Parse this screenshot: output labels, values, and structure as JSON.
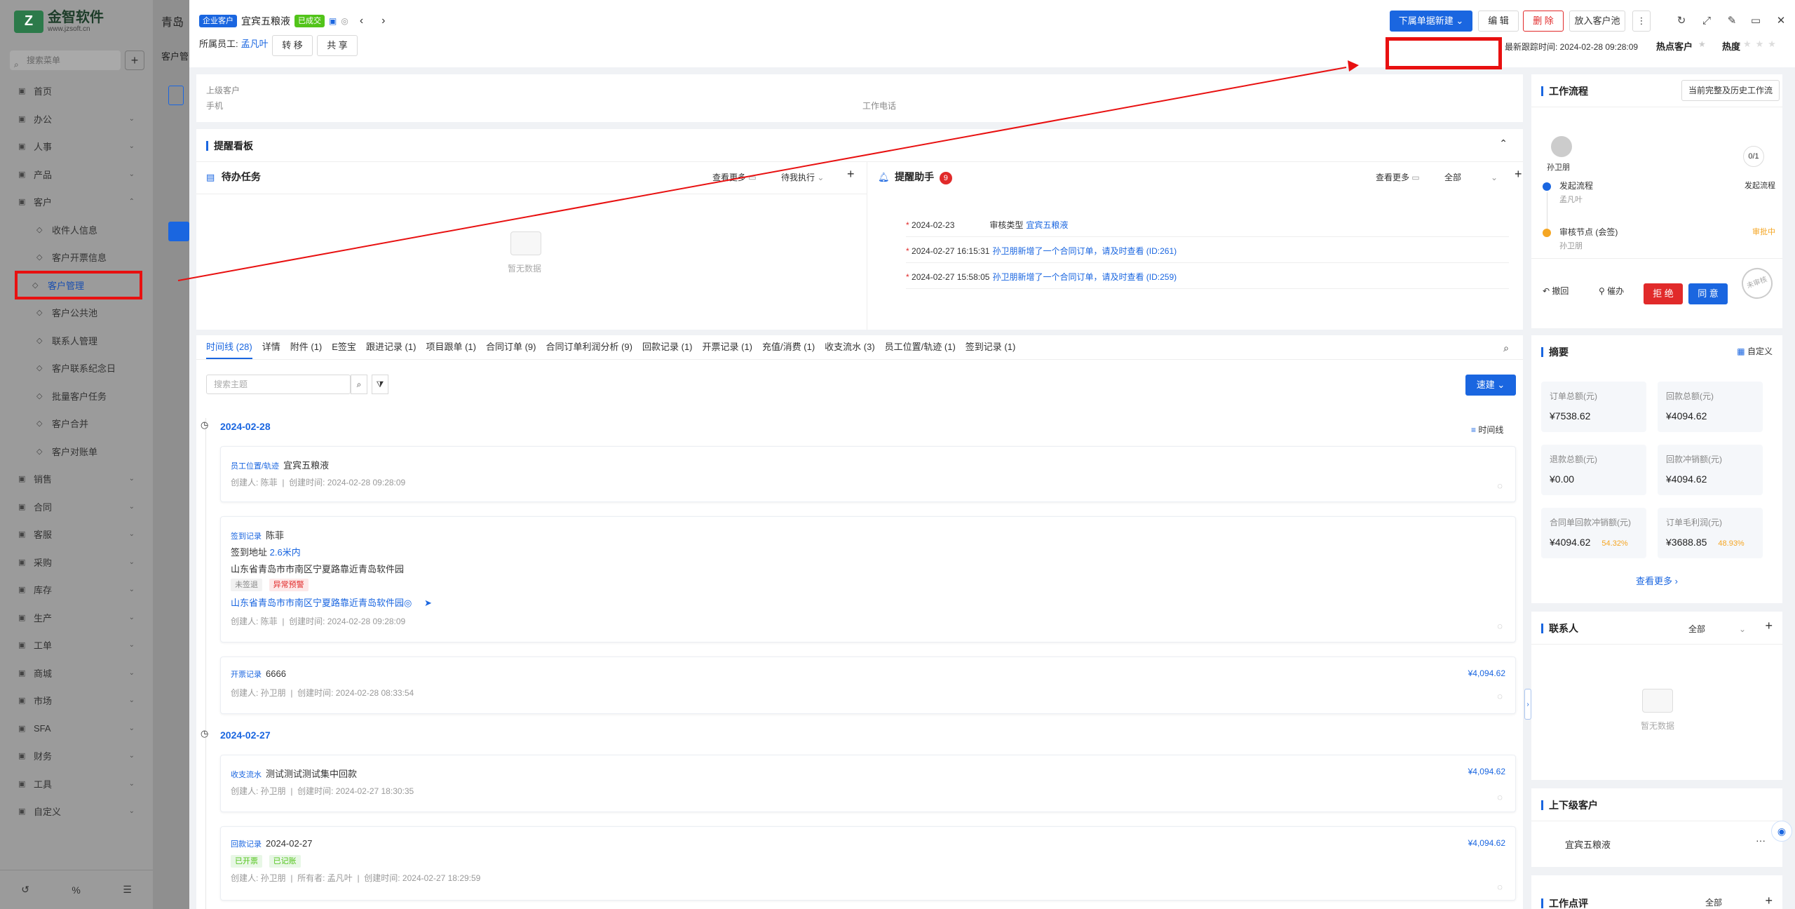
{
  "sidebar": {
    "logo_text": "金智软件",
    "logo_sub": "www.jzsoft.cn",
    "search_placeholder": "搜索菜单",
    "items": [
      {
        "label": "首页",
        "icon": "home-icon"
      },
      {
        "label": "办公",
        "icon": "office-icon"
      },
      {
        "label": "人事",
        "icon": "person-icon"
      },
      {
        "label": "产品",
        "icon": "product-icon"
      },
      {
        "label": "客户",
        "icon": "customer-icon"
      },
      {
        "label": "收件人信息",
        "icon": "sub-icon"
      },
      {
        "label": "客户开票信息",
        "icon": "sub-icon"
      },
      {
        "label": "客户管理",
        "icon": "sub-icon"
      },
      {
        "label": "客户公共池",
        "icon": "sub-icon"
      },
      {
        "label": "联系人管理",
        "icon": "sub-icon"
      },
      {
        "label": "客户联系纪念日",
        "icon": "sub-icon"
      },
      {
        "label": "批量客户任务",
        "icon": "sub-icon"
      },
      {
        "label": "客户合并",
        "icon": "sub-icon"
      },
      {
        "label": "客户对账单",
        "icon": "sub-icon"
      },
      {
        "label": "销售",
        "icon": "sales-icon"
      },
      {
        "label": "合同",
        "icon": "contract-icon"
      },
      {
        "label": "客服",
        "icon": "service-icon"
      },
      {
        "label": "采购",
        "icon": "purchase-icon"
      },
      {
        "label": "库存",
        "icon": "stock-icon"
      },
      {
        "label": "生产",
        "icon": "production-icon"
      },
      {
        "label": "工单",
        "icon": "ticket-icon"
      },
      {
        "label": "商城",
        "icon": "mall-icon"
      },
      {
        "label": "市场",
        "icon": "market-icon"
      },
      {
        "label": "SFA",
        "icon": "sfa-icon"
      },
      {
        "label": "财务",
        "icon": "finance-icon"
      },
      {
        "label": "工具",
        "icon": "tool-icon"
      },
      {
        "label": "自定义",
        "icon": "custom-icon"
      }
    ],
    "bottom": [
      "↺",
      "%",
      "☰"
    ]
  },
  "background": {
    "title": "青岛",
    "sub": "客户管"
  },
  "header": {
    "tag_type": "企业客户",
    "customer_name": "宜宾五粮液",
    "tag_status": "已成交",
    "owner_label": "所属员工:",
    "owner_name": "孟凡叶",
    "transfer_btn": "转 移",
    "share_btn": "共 享",
    "new_order_btn": "下属单据新建",
    "edit_btn": "编 辑",
    "delete_btn": "删 除",
    "pool_btn": "放入客户池",
    "last_follow": "最新跟踪时间: 2024-02-28 09:28:09",
    "hot_customer": "热点客户",
    "heat_label": "热度"
  },
  "info": {
    "parent_label": "上级客户",
    "mobile_label": "手机",
    "work_phone_label": "工作电话"
  },
  "reminder": {
    "title": "提醒看板",
    "todo": {
      "title": "待办任务",
      "more": "查看更多",
      "filter": "待我执行",
      "empty": "暂无数据"
    },
    "assistant": {
      "title": "提醒助手",
      "count": "9",
      "more": "查看更多",
      "filter": "全部",
      "items": [
        {
          "time": "2024-02-23",
          "text": "审核类型",
          "link": "宜宾五粮液"
        },
        {
          "time": "2024-02-27 16:15:31",
          "text": "",
          "link": "孙卫朋新增了一个合同订单，请及时查看 (ID:261)"
        },
        {
          "time": "2024-02-27 15:58:05",
          "text": "",
          "link": "孙卫朋新增了一个合同订单，请及时查看 (ID:259)"
        }
      ]
    }
  },
  "tabs": [
    "时间线 (28)",
    "详情",
    "附件 (1)",
    "E签宝",
    "跟进记录 (1)",
    "项目跟单 (1)",
    "合同订单 (9)",
    "合同订单利润分析 (9)",
    "回款记录 (1)",
    "开票记录 (1)",
    "充值/消费 (1)",
    "收支流水 (3)",
    "员工位置/轨迹 (1)",
    "签到记录 (1)"
  ],
  "timeline": {
    "search_placeholder": "搜索主题",
    "quick_btn": "速建",
    "timeline_toggle": "时间线",
    "dates": [
      "2024-02-28",
      "2024-02-27"
    ],
    "entries": [
      {
        "type": "员工位置/轨迹",
        "title": "宜宾五粮液",
        "creator": "创建人: 陈菲",
        "time": "创建时间: 2024-02-28 09:28:09"
      },
      {
        "type": "签到记录",
        "title": "陈菲",
        "line1": "签到地址",
        "distance": "2.6米内",
        "address": "山东省青岛市市南区宁夏路靠近青岛软件园",
        "tag1": "未签退",
        "tag2": "异常预警",
        "address_link": "山东省青岛市市南区宁夏路靠近青岛软件园◎",
        "creator": "创建人: 陈菲",
        "time": "创建时间: 2024-02-28 09:28:09"
      },
      {
        "type": "开票记录",
        "title": "6666",
        "amount": "¥4,094.62",
        "creator": "创建人: 孙卫朋",
        "time": "创建时间: 2024-02-28 08:33:54"
      },
      {
        "type": "收支流水",
        "title": "测试测试测试集中回款",
        "amount": "¥4,094.62",
        "creator": "创建人: 孙卫朋",
        "time": "创建时间: 2024-02-27 18:30:35"
      },
      {
        "type": "回款记录",
        "title": "2024-02-27",
        "amount": "¥4,094.62",
        "tag1": "已开票",
        "tag2": "已记账",
        "creator": "创建人: 孙卫朋",
        "owner": "所有者: 孟凡叶",
        "time": "创建时间: 2024-02-27 18:29:59"
      }
    ]
  },
  "workflow": {
    "title": "工作流程",
    "history_btn": "当前完整及历史工作流",
    "user": "孙卫朋",
    "ratio": "0/1",
    "step1": {
      "name": "发起流程",
      "person": "孟凡叶",
      "status": "发起流程"
    },
    "step2": {
      "name": "审核节点 (会签)",
      "person": "孙卫朋",
      "status": "审批中"
    },
    "withdraw": "撤回",
    "urge": "催办",
    "reject": "拒 绝",
    "approve": "同 意",
    "stamp": "未审核"
  },
  "summary": {
    "title": "摘要",
    "custom": "自定义",
    "items": [
      {
        "label": "订单总额(元)",
        "value": "¥7538.62",
        "pct": ""
      },
      {
        "label": "回款总额(元)",
        "value": "¥4094.62",
        "pct": ""
      },
      {
        "label": "退款总额(元)",
        "value": "¥0.00",
        "pct": ""
      },
      {
        "label": "回款冲销额(元)",
        "value": "¥4094.62",
        "pct": ""
      },
      {
        "label": "合同单回款冲销额(元)",
        "value": "¥4094.62",
        "pct": "54.32%"
      },
      {
        "label": "订单毛利润(元)",
        "value": "¥3688.85",
        "pct": "48.93%"
      }
    ],
    "more": "查看更多"
  },
  "contacts": {
    "title": "联系人",
    "filter": "全部",
    "empty": "暂无数据"
  },
  "hierarchy": {
    "title": "上下级客户",
    "item": "宜宾五粮液"
  },
  "work_points": {
    "title": "工作点评",
    "filter": "全部"
  },
  "colors": {
    "primary": "#1a66e0",
    "danger": "#e12a2a",
    "annotation": "#e81010"
  }
}
